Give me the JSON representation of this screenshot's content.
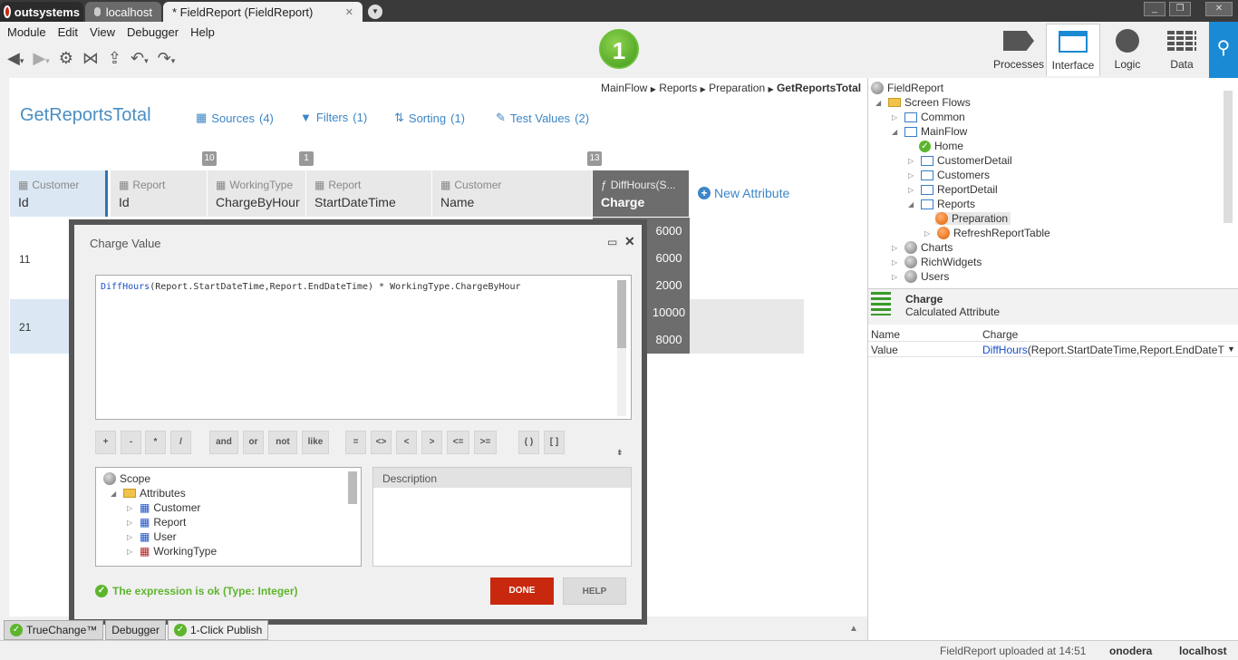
{
  "tabs": {
    "logo": "outsystems",
    "localhost": "localhost",
    "active": "* FieldReport (FieldReport)",
    "close": "✕"
  },
  "menu": [
    "Module",
    "Edit",
    "View",
    "Debugger",
    "Help"
  ],
  "step_number": "1",
  "nav": [
    {
      "label": "Processes",
      "icon": "processes-icon"
    },
    {
      "label": "Interface",
      "icon": "interface-icon"
    },
    {
      "label": "Logic",
      "icon": "logic-icon"
    },
    {
      "label": "Data",
      "icon": "data-icon"
    }
  ],
  "breadcrumb": {
    "a": "MainFlow",
    "b": "Reports",
    "c": "Preparation",
    "d": "GetReportsTotal"
  },
  "page_title": "GetReportsTotal",
  "query_links": [
    {
      "label": "Sources",
      "count": "(4)"
    },
    {
      "label": "Filters",
      "count": "(1)"
    },
    {
      "label": "Sorting",
      "count": "(1)"
    },
    {
      "label": "Test Values",
      "count": "(2)"
    }
  ],
  "columns": [
    {
      "entity": "Customer",
      "attr": "Id"
    },
    {
      "entity": "Report",
      "attr": "Id"
    },
    {
      "entity": "WorkingType",
      "attr": "ChargeByHour"
    },
    {
      "entity": "Report",
      "attr": "StartDateTime"
    },
    {
      "entity": "Customer",
      "attr": "Name"
    },
    {
      "entity": "DiffHours(S...",
      "attr": "Charge"
    }
  ],
  "col_tags": [
    "10",
    "1",
    "13"
  ],
  "new_attribute": "New Attribute",
  "row_ids": [
    "11",
    "21"
  ],
  "charge_values": [
    "6000",
    "6000",
    "2000",
    "10000",
    "8000"
  ],
  "dialog": {
    "title": "Charge Value",
    "expr_fn": "DiffHours",
    "expr_rest": "(Report.StartDateTime,Report.EndDateTime) * WorkingType.ChargeByHour",
    "ops": [
      "+",
      "-",
      "*",
      "/",
      "and",
      "or",
      "not",
      "like",
      "=",
      "<>",
      "<",
      ">",
      "<=",
      ">=",
      "( )",
      "[ ]"
    ],
    "scope_root": "Scope",
    "scope_folder": "Attributes",
    "scope_items": [
      "Customer",
      "Report",
      "User",
      "WorkingType"
    ],
    "description_header": "Description",
    "status": "The expression is ok (Type: Integer)",
    "done": "DONE",
    "help": "HELP"
  },
  "tree": {
    "root": "FieldReport",
    "screen_flows": "Screen Flows",
    "common": "Common",
    "mainflow": "MainFlow",
    "home": "Home",
    "customer_detail": "CustomerDetail",
    "customers": "Customers",
    "report_detail": "ReportDetail",
    "reports": "Reports",
    "preparation": "Preparation",
    "refresh": "RefreshReportTable",
    "charts": "Charts",
    "richwidgets": "RichWidgets",
    "users": "Users"
  },
  "props": {
    "title": "Charge",
    "subtitle": "Calculated Attribute",
    "name_label": "Name",
    "name_value": "Charge",
    "value_label": "Value",
    "value_fn": "DiffHours",
    "value_rest": "(Report.StartDateTime,Report.EndDateT"
  },
  "bottom_tabs": [
    "TrueChange™",
    "Debugger",
    "1-Click Publish"
  ],
  "status": {
    "upload": "FieldReport uploaded at 14:51",
    "user": "onodera",
    "server": "localhost"
  },
  "colors": {
    "accent_blue": "#3d86c6",
    "ok_green": "#5db52e",
    "done_red": "#c8290e",
    "search_blue": "#1a8ad4"
  }
}
